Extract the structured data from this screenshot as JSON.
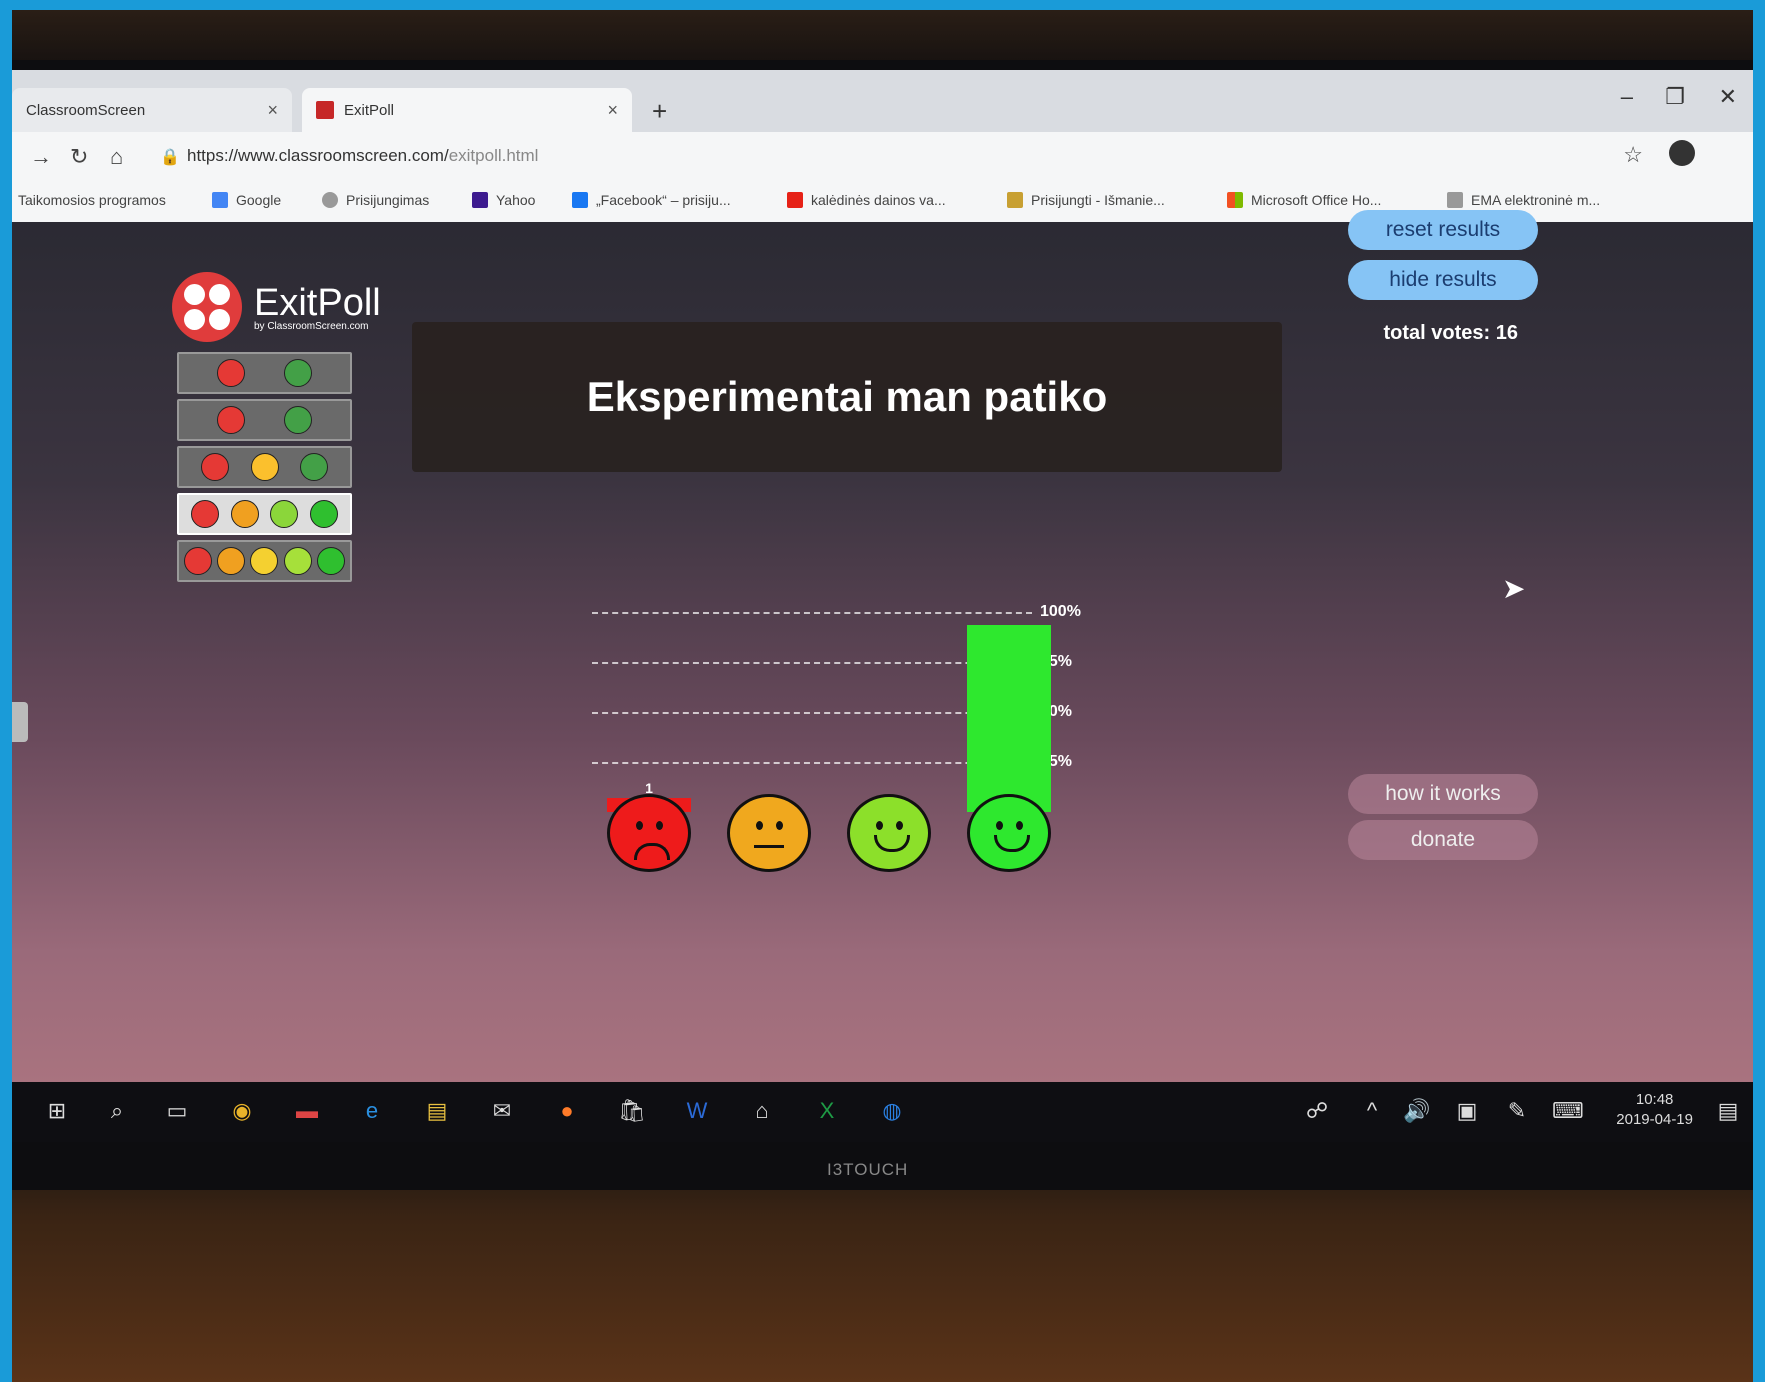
{
  "browser": {
    "tabs": [
      {
        "label": "ClassroomScreen",
        "active": false
      },
      {
        "label": "ExitPoll",
        "active": true
      }
    ],
    "url_main": "https://www.classroomscreen.com/",
    "url_dim": "exitpoll.html",
    "bookmarks": [
      {
        "label": "Taikomosios programos",
        "icon": "apps-icon",
        "color": ""
      },
      {
        "label": "Google",
        "icon": "google-icon",
        "color": "#4285f4"
      },
      {
        "label": "Prisijungimas",
        "icon": "globe-icon",
        "color": "#999999"
      },
      {
        "label": "Yahoo",
        "icon": "yahoo-icon",
        "color": "#3d1a8f"
      },
      {
        "label": "„Facebook“ – prisiju...",
        "icon": "facebook-icon",
        "color": "#1877f2"
      },
      {
        "label": "kalėdinės dainos va...",
        "icon": "youtube-icon",
        "color": "#e62117"
      },
      {
        "label": "Prisijungti - Išmanie...",
        "icon": "hat-icon",
        "color": "#c8a032"
      },
      {
        "label": "Microsoft Office Ho...",
        "icon": "office-icon",
        "color": "#f25022"
      },
      {
        "label": "EMA elektroninė m...",
        "icon": "ema-icon",
        "color": "#999999"
      }
    ]
  },
  "app": {
    "logo_title": "ExitPoll",
    "logo_sub": "by ClassroomScreen.com",
    "question": "Eksperimentai man patiko",
    "reset_label": "reset results",
    "hide_label": "hide results",
    "total_votes": "total votes: 16",
    "how_label": "how it works",
    "donate_label": "donate",
    "presets": [
      [
        "#e53935",
        "#43a047"
      ],
      [
        "#e53935",
        "#43a047"
      ],
      [
        "#e53935",
        "#fbc02d",
        "#43a047"
      ],
      [
        "#e53935",
        "#f0a020",
        "#8bd63a",
        "#2fbf2f"
      ],
      [
        "#e53935",
        "#f0a020",
        "#f4d030",
        "#a6e03a",
        "#2fbf2f"
      ]
    ]
  },
  "chart_data": {
    "type": "bar",
    "categories": [
      "very-sad",
      "neutral",
      "happy",
      "very-happy"
    ],
    "values": [
      1,
      0,
      0,
      15
    ],
    "value_labels": [
      "1",
      "0",
      "0",
      "15"
    ],
    "colors": [
      "#ee1b1b",
      "#f0a81e",
      "#8ce02a",
      "#2ee82e"
    ],
    "y_ticks": [
      "100%",
      "75%",
      "50%",
      "25%"
    ],
    "ylim": [
      0,
      16
    ]
  },
  "taskbar": {
    "time": "10:48",
    "date": "2019-04-19",
    "brand": "I3TOUCH"
  }
}
